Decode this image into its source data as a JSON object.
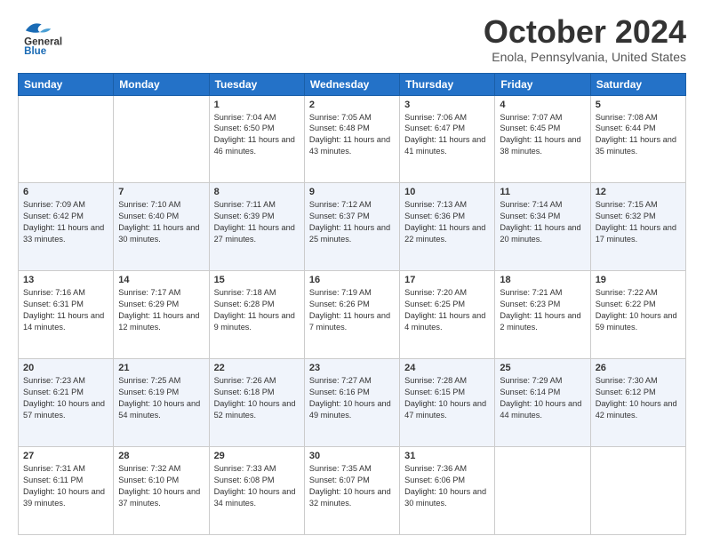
{
  "logo": {
    "general": "General",
    "blue": "Blue"
  },
  "header": {
    "month": "October 2024",
    "location": "Enola, Pennsylvania, United States"
  },
  "weekdays": [
    "Sunday",
    "Monday",
    "Tuesday",
    "Wednesday",
    "Thursday",
    "Friday",
    "Saturday"
  ],
  "weeks": [
    [
      {
        "day": "",
        "info": ""
      },
      {
        "day": "",
        "info": ""
      },
      {
        "day": "1",
        "info": "Sunrise: 7:04 AM\nSunset: 6:50 PM\nDaylight: 11 hours and 46 minutes."
      },
      {
        "day": "2",
        "info": "Sunrise: 7:05 AM\nSunset: 6:48 PM\nDaylight: 11 hours and 43 minutes."
      },
      {
        "day": "3",
        "info": "Sunrise: 7:06 AM\nSunset: 6:47 PM\nDaylight: 11 hours and 41 minutes."
      },
      {
        "day": "4",
        "info": "Sunrise: 7:07 AM\nSunset: 6:45 PM\nDaylight: 11 hours and 38 minutes."
      },
      {
        "day": "5",
        "info": "Sunrise: 7:08 AM\nSunset: 6:44 PM\nDaylight: 11 hours and 35 minutes."
      }
    ],
    [
      {
        "day": "6",
        "info": "Sunrise: 7:09 AM\nSunset: 6:42 PM\nDaylight: 11 hours and 33 minutes."
      },
      {
        "day": "7",
        "info": "Sunrise: 7:10 AM\nSunset: 6:40 PM\nDaylight: 11 hours and 30 minutes."
      },
      {
        "day": "8",
        "info": "Sunrise: 7:11 AM\nSunset: 6:39 PM\nDaylight: 11 hours and 27 minutes."
      },
      {
        "day": "9",
        "info": "Sunrise: 7:12 AM\nSunset: 6:37 PM\nDaylight: 11 hours and 25 minutes."
      },
      {
        "day": "10",
        "info": "Sunrise: 7:13 AM\nSunset: 6:36 PM\nDaylight: 11 hours and 22 minutes."
      },
      {
        "day": "11",
        "info": "Sunrise: 7:14 AM\nSunset: 6:34 PM\nDaylight: 11 hours and 20 minutes."
      },
      {
        "day": "12",
        "info": "Sunrise: 7:15 AM\nSunset: 6:32 PM\nDaylight: 11 hours and 17 minutes."
      }
    ],
    [
      {
        "day": "13",
        "info": "Sunrise: 7:16 AM\nSunset: 6:31 PM\nDaylight: 11 hours and 14 minutes."
      },
      {
        "day": "14",
        "info": "Sunrise: 7:17 AM\nSunset: 6:29 PM\nDaylight: 11 hours and 12 minutes."
      },
      {
        "day": "15",
        "info": "Sunrise: 7:18 AM\nSunset: 6:28 PM\nDaylight: 11 hours and 9 minutes."
      },
      {
        "day": "16",
        "info": "Sunrise: 7:19 AM\nSunset: 6:26 PM\nDaylight: 11 hours and 7 minutes."
      },
      {
        "day": "17",
        "info": "Sunrise: 7:20 AM\nSunset: 6:25 PM\nDaylight: 11 hours and 4 minutes."
      },
      {
        "day": "18",
        "info": "Sunrise: 7:21 AM\nSunset: 6:23 PM\nDaylight: 11 hours and 2 minutes."
      },
      {
        "day": "19",
        "info": "Sunrise: 7:22 AM\nSunset: 6:22 PM\nDaylight: 10 hours and 59 minutes."
      }
    ],
    [
      {
        "day": "20",
        "info": "Sunrise: 7:23 AM\nSunset: 6:21 PM\nDaylight: 10 hours and 57 minutes."
      },
      {
        "day": "21",
        "info": "Sunrise: 7:25 AM\nSunset: 6:19 PM\nDaylight: 10 hours and 54 minutes."
      },
      {
        "day": "22",
        "info": "Sunrise: 7:26 AM\nSunset: 6:18 PM\nDaylight: 10 hours and 52 minutes."
      },
      {
        "day": "23",
        "info": "Sunrise: 7:27 AM\nSunset: 6:16 PM\nDaylight: 10 hours and 49 minutes."
      },
      {
        "day": "24",
        "info": "Sunrise: 7:28 AM\nSunset: 6:15 PM\nDaylight: 10 hours and 47 minutes."
      },
      {
        "day": "25",
        "info": "Sunrise: 7:29 AM\nSunset: 6:14 PM\nDaylight: 10 hours and 44 minutes."
      },
      {
        "day": "26",
        "info": "Sunrise: 7:30 AM\nSunset: 6:12 PM\nDaylight: 10 hours and 42 minutes."
      }
    ],
    [
      {
        "day": "27",
        "info": "Sunrise: 7:31 AM\nSunset: 6:11 PM\nDaylight: 10 hours and 39 minutes."
      },
      {
        "day": "28",
        "info": "Sunrise: 7:32 AM\nSunset: 6:10 PM\nDaylight: 10 hours and 37 minutes."
      },
      {
        "day": "29",
        "info": "Sunrise: 7:33 AM\nSunset: 6:08 PM\nDaylight: 10 hours and 34 minutes."
      },
      {
        "day": "30",
        "info": "Sunrise: 7:35 AM\nSunset: 6:07 PM\nDaylight: 10 hours and 32 minutes."
      },
      {
        "day": "31",
        "info": "Sunrise: 7:36 AM\nSunset: 6:06 PM\nDaylight: 10 hours and 30 minutes."
      },
      {
        "day": "",
        "info": ""
      },
      {
        "day": "",
        "info": ""
      }
    ]
  ]
}
